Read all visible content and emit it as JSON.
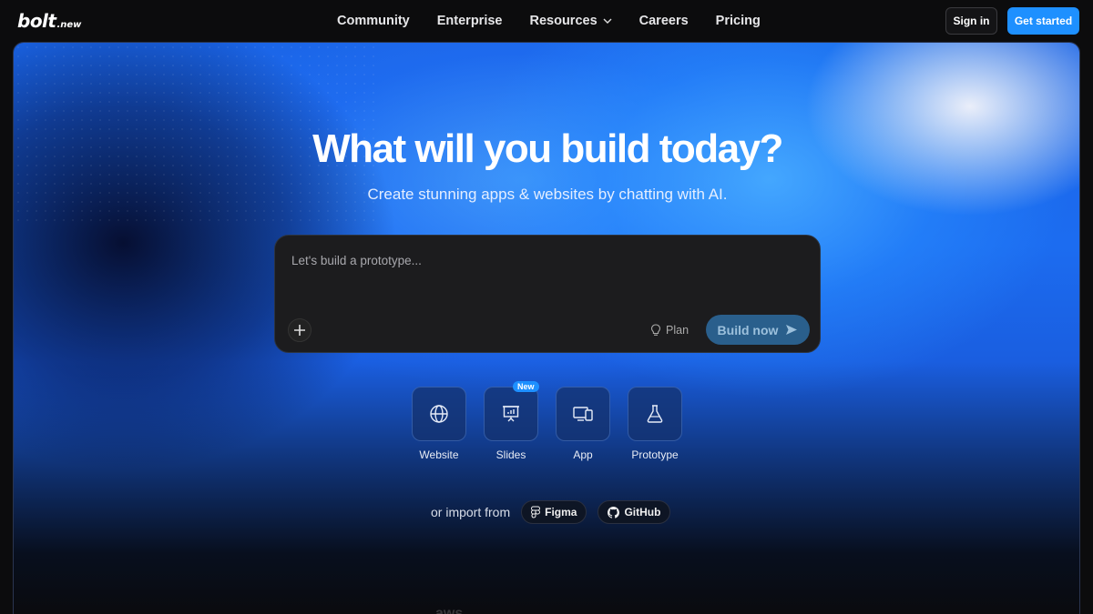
{
  "brand": {
    "name": "bolt",
    "suffix": ".new"
  },
  "nav": {
    "links": [
      "Community",
      "Enterprise",
      "Resources",
      "Careers",
      "Pricing"
    ],
    "signin": "Sign in",
    "get_started": "Get started"
  },
  "hero": {
    "title": "What will you build today?",
    "subtitle": "Create stunning apps & websites by chatting with AI."
  },
  "prompt": {
    "placeholder": "Let's build a prototype...",
    "plan_label": "Plan",
    "build_label": "Build now"
  },
  "options": [
    {
      "label": "Website",
      "icon": "globe-icon"
    },
    {
      "label": "Slides",
      "icon": "presentation-icon",
      "badge": "New"
    },
    {
      "label": "App",
      "icon": "devices-icon"
    },
    {
      "label": "Prototype",
      "icon": "flask-icon"
    }
  ],
  "import": {
    "label": "or import from",
    "figma": "Figma",
    "github": "GitHub"
  },
  "logos": {
    "aws": "aws"
  },
  "colors": {
    "accent": "#1e90ff",
    "prompt_bg": "#1c1c1e",
    "page_bg": "#0c0c0d"
  }
}
